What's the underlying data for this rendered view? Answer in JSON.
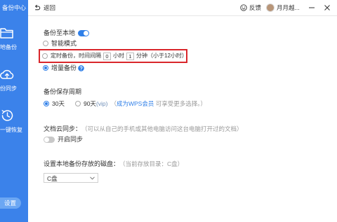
{
  "colors": {
    "accent": "#2f7fe8",
    "sidebar": "#3b82ea",
    "sidebar_pill": "#6ca7f3",
    "highlight_box": "#d9262b"
  },
  "sidebar": {
    "title": "备份中心",
    "items": [
      {
        "icon": "folder-icon",
        "label": "地备份"
      },
      {
        "icon": "cloud-upload-icon",
        "label": "份同步"
      },
      {
        "icon": "restore-clock-icon",
        "label": "一键恢复"
      }
    ],
    "settings_label": "设置"
  },
  "topbar": {
    "back_icon": "back-arrow-icon",
    "back_label": "返回",
    "feedback_icon": "smile-icon",
    "feedback_label": "反馈",
    "username": "月月越...",
    "minimize_icon": "minimize-icon",
    "close_icon": "close-icon"
  },
  "local_backup": {
    "label": "备份至本地",
    "enabled": true,
    "smart_mode": {
      "label": "智能模式",
      "selected": false
    },
    "schedule": {
      "label": "定时备份，时间间隔",
      "selected": false,
      "hours_value": "0",
      "hours_unit": "小时",
      "minutes_value": "1",
      "minutes_unit": "分钟",
      "note": "（小于12小时）"
    },
    "incremental": {
      "label": "增量备份",
      "selected": true,
      "help_icon": "help-icon"
    }
  },
  "retention": {
    "title": "备份保存周期",
    "options": [
      {
        "label": "30天",
        "selected": true
      },
      {
        "label": "90天",
        "tag": "(vip)",
        "selected": false
      }
    ],
    "upsell_open": "（",
    "upsell_link": "成为WPS会员",
    "upsell_text": " 可享受更多选择。）"
  },
  "cloud_sync": {
    "title": "文档云同步：",
    "note": "（可以从自己的手机或其他电脑访问这台电脑打开过的文档）",
    "toggle_label": "开启同步",
    "enabled": false
  },
  "disk": {
    "title": "设置本地备份存放的磁盘：",
    "note": "（当前存放目录：C盘）",
    "selected": "C盘"
  }
}
